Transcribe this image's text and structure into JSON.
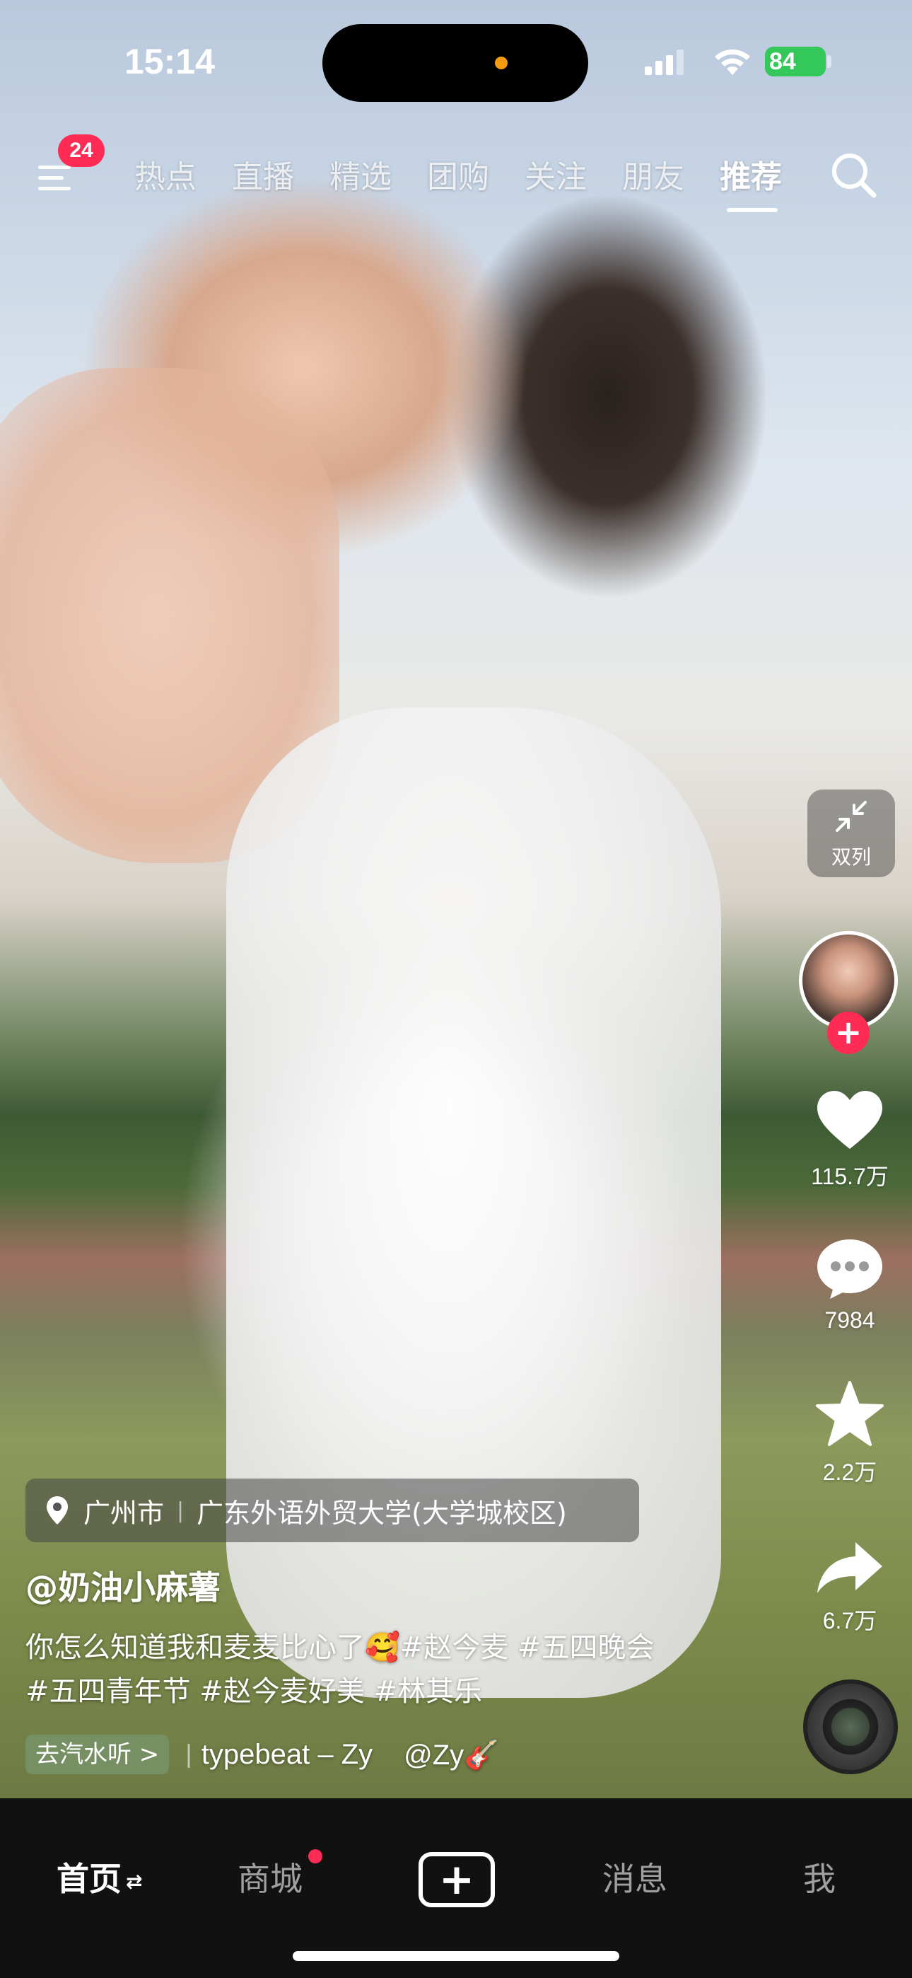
{
  "status_bar": {
    "time": "15:14",
    "battery": "84"
  },
  "top_nav": {
    "menu_badge": "24",
    "tabs": [
      {
        "label": "热点"
      },
      {
        "label": "直播"
      },
      {
        "label": "精选"
      },
      {
        "label": "团购"
      },
      {
        "label": "关注"
      },
      {
        "label": "朋友"
      },
      {
        "label": "推荐"
      }
    ],
    "active_tab": "推荐"
  },
  "actions": {
    "dual_column_label": "双列",
    "likes": "115.7万",
    "comments": "7984",
    "favorites": "2.2万",
    "shares": "6.7万"
  },
  "video_info": {
    "location_city": "广州市",
    "location_place": "广东外语外贸大学(大学城校区)",
    "author": "@奶油小麻薯",
    "caption_line1": "你怎么知道我和麦麦比心了🥰#赵今麦 #五四晚会",
    "caption_line2": "#五四青年节 #赵今麦好美 #林其乐",
    "qishui_label": "去汽水听 >",
    "music_title": "typebeat – Zy",
    "music_author": "@Zy🎸"
  },
  "tab_bar": {
    "home": "首页",
    "shop": "商城",
    "messages": "消息",
    "me": "我"
  },
  "colors": {
    "accent": "#fe2c55",
    "battery": "#34c759",
    "tab_bar_bg": "#111111"
  }
}
